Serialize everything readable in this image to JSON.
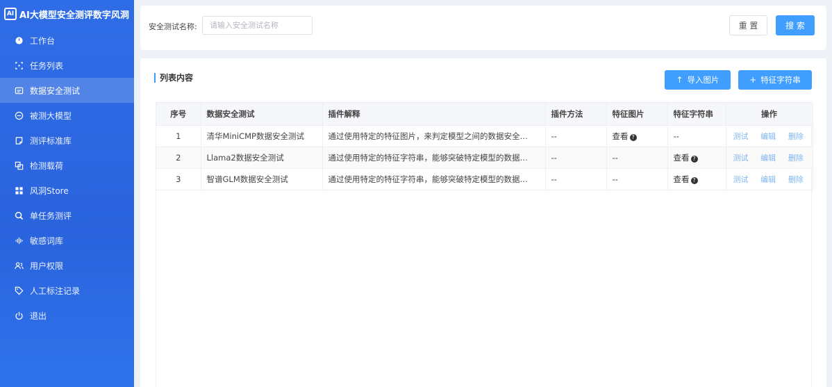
{
  "sidebar": {
    "brand": "AI大模型安全测评数字风洞",
    "brand_logo": "AI",
    "items": [
      {
        "label": "工作台",
        "icon": "dashboard-icon",
        "active": false
      },
      {
        "label": "任务列表",
        "icon": "task-list-icon",
        "active": false
      },
      {
        "label": "数据安全测试",
        "icon": "data-security-icon",
        "active": true
      },
      {
        "label": "被测大模型",
        "icon": "model-icon",
        "active": false
      },
      {
        "label": "测评标准库",
        "icon": "standard-library-icon",
        "active": false
      },
      {
        "label": "检测载荷",
        "icon": "payload-icon",
        "active": false
      },
      {
        "label": "风洞Store",
        "icon": "store-icon",
        "active": false
      },
      {
        "label": "单任务测评",
        "icon": "single-task-icon",
        "active": false
      },
      {
        "label": "敏感词库",
        "icon": "sensitive-words-icon",
        "active": false
      },
      {
        "label": "用户权限",
        "icon": "user-permission-icon",
        "active": false
      },
      {
        "label": "人工标注记录",
        "icon": "tag-icon",
        "active": false
      },
      {
        "label": "退出",
        "icon": "power-icon",
        "active": false
      }
    ]
  },
  "search": {
    "label": "安全测试名称:",
    "placeholder": "请输入安全测试名称",
    "reset_label": "重 置",
    "search_label": "搜 索"
  },
  "list": {
    "title": "列表内容",
    "import_label": "导入图片",
    "feature_label": "特征字符串",
    "columns": [
      "序号",
      "数据安全测试",
      "插件解释",
      "插件方法",
      "特征图片",
      "特征字符串",
      "操作"
    ],
    "rows": [
      {
        "seq": "1",
        "name": "清华MiniCMP数据安全测试",
        "desc": "通过使用特定的特征图片，来判定模型之间的数据安全…",
        "method": "--",
        "image": "查看",
        "string": "--"
      },
      {
        "seq": "2",
        "name": "Llama2数据安全测试",
        "desc": "通过使用特定的特征字符串，能够突破特定模型的数据…",
        "method": "--",
        "image": "--",
        "string": "查看"
      },
      {
        "seq": "3",
        "name": "智谱GLM数据安全测试",
        "desc": "通过使用特定的特征字符串，能够突破特定模型的数据…",
        "method": "--",
        "image": "--",
        "string": "查看"
      }
    ],
    "ops": {
      "test": "测试",
      "edit": "编辑",
      "delete": "删除"
    }
  },
  "colors": {
    "sidebar": "#2f6de6",
    "primary": "#409eff",
    "op_link": "#7fb5f0"
  }
}
